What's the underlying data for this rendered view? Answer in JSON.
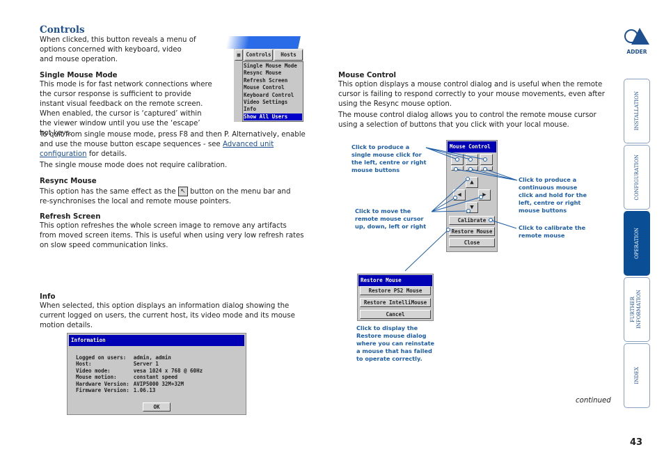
{
  "heading": "Controls",
  "intro": "When clicked, this button reveals a menu of options concerned with keyboard, video and mouse operation.",
  "menu": {
    "tabs": [
      "Controls",
      "Hosts"
    ],
    "items": [
      "Single Mouse Mode",
      "Resync Mouse",
      "Refresh Screen",
      "Mouse Control",
      "Keyboard Control",
      "Video Settings",
      "Info",
      "Show All Users"
    ],
    "highlighted": "Show All Users"
  },
  "single": {
    "title": "Single Mouse Mode",
    "body": "This mode is for fast network connections where the cursor response is sufficient to provide instant visual feedback on the remote screen. When enabled, the cursor is ‘captured’ within the viewer window until you use the ‘escape’ hot keys.",
    "body2": "To quit from single mouse mode, press F8 and then P. Alternatively, enable and use the mouse button escape sequences - see",
    "link": "Advanced unit configuration",
    "after_link": " for details.",
    "note": "The single mouse mode does not require calibration."
  },
  "resync": {
    "title": "Resync Mouse",
    "body_a": "This option has the same effect as the",
    "body_b": "button on the menu bar and re-synchronises the local and remote mouse pointers."
  },
  "refresh": {
    "title": "Refresh Screen",
    "body": "This option refreshes the whole screen image to remove any artifacts from moved screen items. This is useful when using very low refresh rates on slow speed communication links."
  },
  "info": {
    "title": "Info",
    "body": "When selected, this option displays an information dialog showing the current logged on users, the current host, its video mode and its mouse motion details."
  },
  "info_dialog": {
    "title": "Information",
    "rows": [
      [
        "Logged on users:",
        "admin, admin"
      ],
      [
        "Host:",
        "Server 1"
      ],
      [
        "Video mode:",
        "vesa 1024 x 768 @ 60Hz"
      ],
      [
        "Mouse motion:",
        "constant speed"
      ],
      [
        "Hardware Version:",
        "AVIP5000 32M+32M"
      ],
      [
        "Firmware Version:",
        "1.06.13"
      ]
    ],
    "ok": "OK"
  },
  "mouse_control": {
    "title": "Mouse Control",
    "body": "This option displays a mouse control dialog and is useful when the remote cursor is failing to respond correctly to your mouse movements, even after using the Resync mouse option.",
    "body2": "The mouse control dialog allows you to control the remote mouse cursor using a selection of buttons that you click with your local mouse."
  },
  "mc_dialog": {
    "title": "Mouse Control",
    "calibrate": "Calibrate",
    "restore": "Restore Mouse",
    "close": "Close"
  },
  "restore_dialog": {
    "title": "Restore Mouse",
    "buttons": [
      "Restore PS2 Mouse",
      "Restore IntelliMouse",
      "Cancel"
    ]
  },
  "callouts": {
    "single": "Click to produce a single mouse click for the left, centre or right mouse buttons",
    "hold": "Click to produce a continuous mouse click and hold for the left, centre or right mouse buttons",
    "move": "Click to move the remote mouse cursor up, down, left or right",
    "calibrate": "Click to calibrate the remote mouse",
    "restore": "Click to display the Restore mouse dialog where you can reinstate a mouse that has failed to operate correctly."
  },
  "continued": "continued",
  "page_number": "43",
  "logo": "ADDER",
  "nav": {
    "tabs": [
      "INSTALLATION",
      "CONFIGURATION",
      "OPERATION",
      "FURTHER INFORMATION",
      "INDEX"
    ],
    "active": "OPERATION"
  },
  "colors": {
    "brand": "#1d4f91",
    "titlebar": "#0000b4",
    "active_tab": "#0a4f96"
  }
}
